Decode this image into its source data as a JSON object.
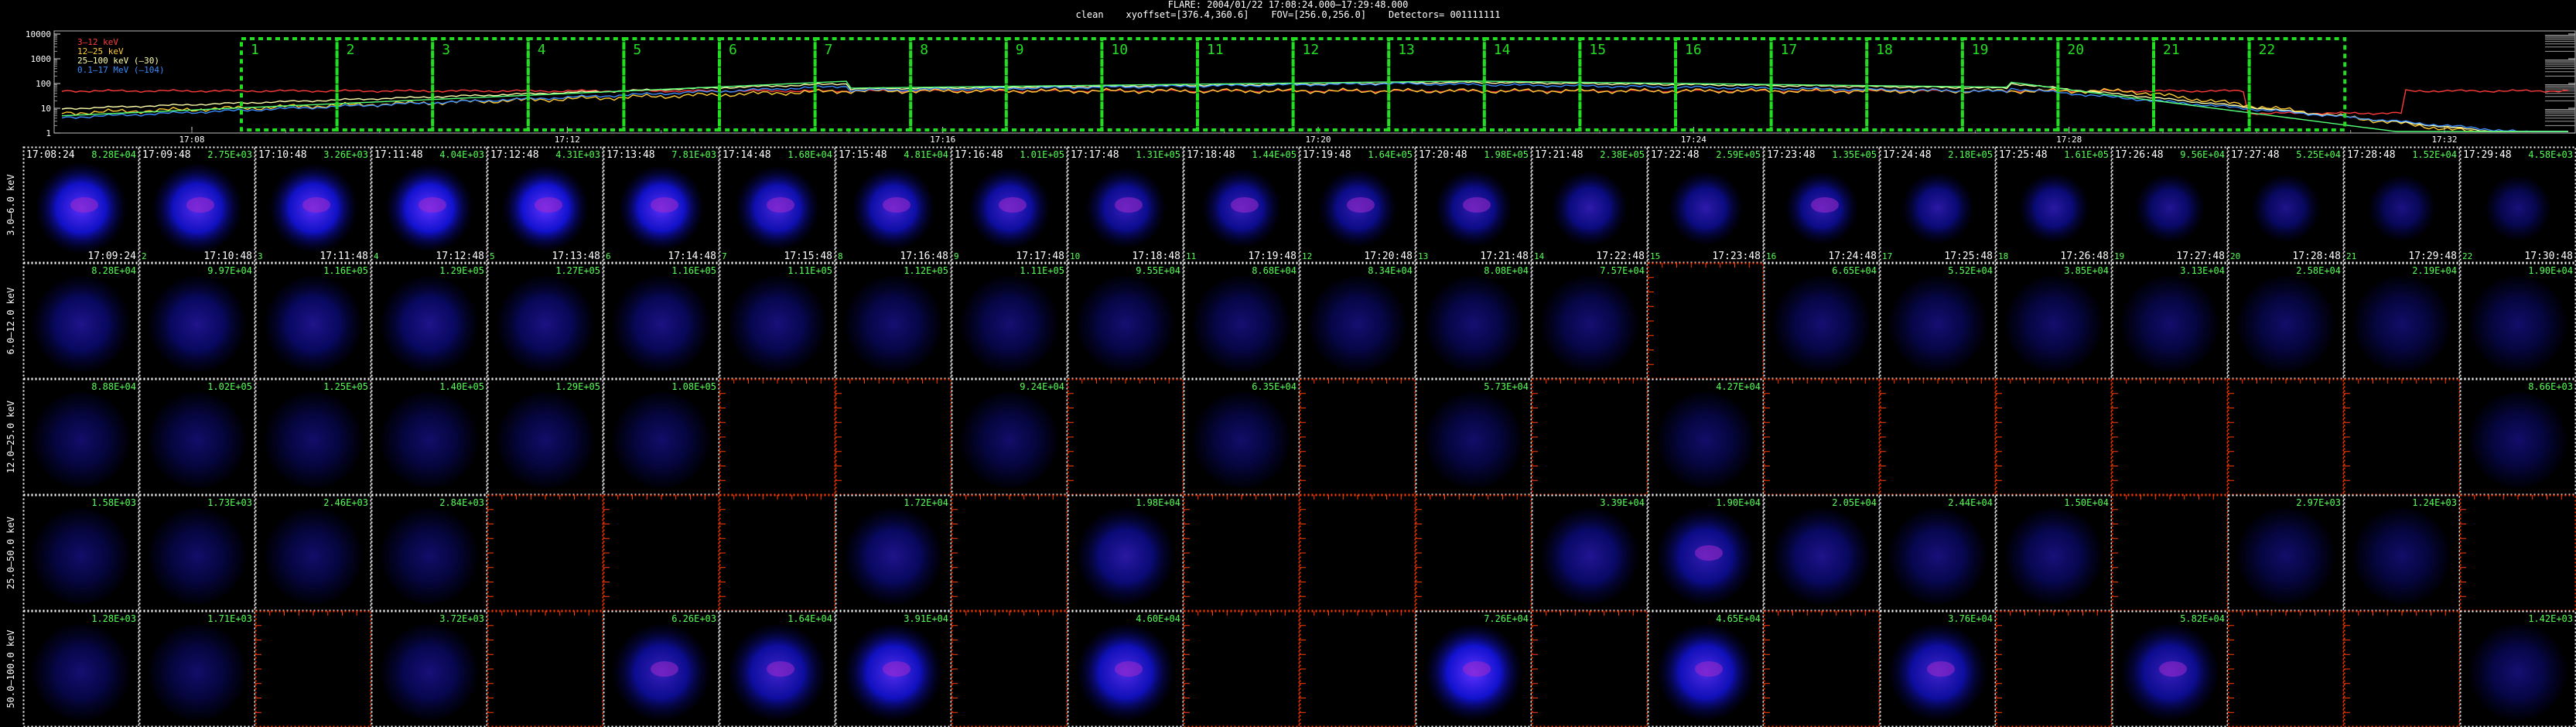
{
  "header": {
    "line1": "FLARE: 2004/01/22 17:08:24.000–17:29:48.000",
    "line2": "clean    xyoffset=[376.4,360.6]    FOV=[256.0,256.0]    Detectors= 001111111"
  },
  "lightcurve": {
    "y_ticks": [
      "10000",
      "1000",
      "100",
      "10",
      "1"
    ],
    "x_ticks": [
      "17:08",
      "17:12",
      "17:16",
      "17:20",
      "17:24",
      "17:28",
      "17:32"
    ],
    "legend": [
      {
        "label": "3–12 keV",
        "color": "#ff3b3b"
      },
      {
        "label": "12–25 keV",
        "color": "#ffcc33"
      },
      {
        "label": "25–100 keV (–30)",
        "color": "#ffffaa"
      },
      {
        "label": "0.1–17 MeV (–104)",
        "color": "#3b8cff"
      }
    ],
    "interval_numbers": [
      "1",
      "2",
      "3",
      "4",
      "5",
      "6",
      "7",
      "8",
      "9",
      "10",
      "11",
      "12",
      "13",
      "14",
      "15",
      "16",
      "17",
      "18",
      "19",
      "20",
      "21",
      "22"
    ],
    "curve_color_green": "#55ff77"
  },
  "grid": {
    "energy_bands": [
      "3.0–6.0 keV",
      "6.0–12.0 keV",
      "12.0–25.0 keV",
      "25.0–50.0 keV",
      "50.0–100.0 keV"
    ],
    "start_times": [
      "17:08:24",
      "17:09:48",
      "17:10:48",
      "17:11:48",
      "17:12:48",
      "17:13:48",
      "17:14:48",
      "17:15:48",
      "17:16:48",
      "17:17:48",
      "17:18:48",
      "17:19:48",
      "17:20:48",
      "17:21:48",
      "17:22:48",
      "17:23:48",
      "17:24:48",
      "17:25:48",
      "17:26:48",
      "17:27:48",
      "17:28:48",
      "17:29:48"
    ],
    "end_times": [
      "17:09:24",
      "17:10:48",
      "17:11:48",
      "17:12:48",
      "17:13:48",
      "17:14:48",
      "17:15:48",
      "17:16:48",
      "17:17:48",
      "17:18:48",
      "17:19:48",
      "17:20:48",
      "17:21:48",
      "17:22:48",
      "17:23:48",
      "17:24:48",
      "17:25:48",
      "17:26:48",
      "17:27:48",
      "17:28:48",
      "17:29:48",
      "17:30:48"
    ],
    "bottom_index_numbers": [
      "2",
      "3",
      "4",
      "5",
      "6",
      "7",
      "8",
      "9",
      "10",
      "11",
      "12",
      "13",
      "14",
      "15",
      "16",
      "17",
      "18",
      "19",
      "20",
      "21",
      "22"
    ],
    "rows": [
      {
        "values": [
          "8.28E+04",
          "2.75E+03",
          "3.26E+03",
          "4.04E+03",
          "4.31E+03",
          "7.81E+03",
          "1.68E+04",
          "4.81E+04",
          "1.01E+05",
          "1.31E+05",
          "1.44E+05",
          "1.64E+05",
          "1.98E+05",
          "2.38E+05",
          "2.59E+05",
          "1.35E+05",
          "2.18E+05",
          "1.61E+05",
          "9.56E+04",
          "5.25E+04",
          "1.52E+04",
          "4.58E+03"
        ],
        "status": [
          "img",
          "img",
          "img",
          "img",
          "img",
          "img",
          "img",
          "img",
          "img",
          "img",
          "img",
          "img",
          "img",
          "img",
          "img",
          "img",
          "img",
          "img",
          "img",
          "img",
          "img",
          "img"
        ],
        "intensity": [
          0.95,
          0.9,
          0.95,
          1.0,
          1.0,
          0.95,
          0.8,
          0.75,
          0.7,
          0.6,
          0.6,
          0.55,
          0.55,
          0.5,
          0.5,
          0.55,
          0.45,
          0.45,
          0.35,
          0.3,
          0.25,
          0.2
        ]
      },
      {
        "values": [
          "8.28E+04",
          "9.97E+04",
          "1.16E+05",
          "1.29E+05",
          "1.27E+05",
          "1.16E+05",
          "1.11E+05",
          "1.12E+05",
          "1.11E+05",
          "9.55E+04",
          "8.68E+04",
          "8.34E+04",
          "8.08E+04",
          "7.57E+04",
          "",
          "6.65E+04",
          "5.52E+04",
          "3.85E+04",
          "3.13E+04",
          "2.58E+04",
          "2.19E+04",
          "1.90E+04"
        ],
        "status": [
          "img",
          "img",
          "img",
          "img",
          "img",
          "img",
          "img",
          "img",
          "img",
          "img",
          "img",
          "img",
          "img",
          "img",
          "black",
          "img",
          "img",
          "img",
          "img",
          "img",
          "img",
          "img"
        ],
        "intensity": [
          0.3,
          0.3,
          0.3,
          0.3,
          0.25,
          0.25,
          0.2,
          0.15,
          0.15,
          0.15,
          0.15,
          0.15,
          0.15,
          0.15,
          0,
          0.15,
          0.15,
          0.12,
          0.12,
          0.1,
          0.1,
          0.1
        ]
      },
      {
        "values": [
          "8.88E+04",
          "1.02E+05",
          "1.25E+05",
          "1.40E+05",
          "1.29E+05",
          "1.08E+05",
          "",
          "",
          "9.24E+04",
          "",
          "6.35E+04",
          "",
          "5.73E+04",
          "",
          "4.27E+04",
          "",
          "",
          "",
          "",
          "",
          "",
          "8.66E+03"
        ],
        "status": [
          "img",
          "img",
          "img",
          "img",
          "img",
          "img",
          "black",
          "black",
          "img",
          "black",
          "img",
          "black",
          "img",
          "black",
          "img",
          "black",
          "black",
          "black",
          "black",
          "black",
          "black",
          "img"
        ],
        "intensity": [
          0.1,
          0.1,
          0.1,
          0.1,
          0.1,
          0.1,
          0,
          0,
          0.1,
          0,
          0.1,
          0,
          0.1,
          0,
          0.1,
          0,
          0,
          0,
          0,
          0,
          0,
          0.1
        ]
      },
      {
        "values": [
          "1.58E+03",
          "1.73E+03",
          "2.46E+03",
          "2.84E+03",
          "",
          "",
          "",
          "1.72E+04",
          "",
          "1.98E+04",
          "",
          "",
          "",
          "3.39E+04",
          "1.90E+04",
          "2.05E+04",
          "2.44E+04",
          "1.50E+04",
          "",
          "2.97E+03",
          "1.24E+03",
          ""
        ],
        "status": [
          "img",
          "img",
          "img",
          "img",
          "black",
          "black",
          "black",
          "img",
          "black",
          "img",
          "black",
          "black",
          "black",
          "img",
          "img",
          "img",
          "img",
          "img",
          "black",
          "img",
          "img",
          "black"
        ],
        "intensity": [
          0.1,
          0.1,
          0.1,
          0.1,
          0,
          0,
          0,
          0.3,
          0,
          0.45,
          0,
          0,
          0,
          0.35,
          0.55,
          0.3,
          0.2,
          0.2,
          0,
          0.1,
          0.1,
          0
        ]
      },
      {
        "values": [
          "1.28E+03",
          "1.71E+03",
          "",
          "3.72E+03",
          "",
          "6.26E+03",
          "1.64E+04",
          "3.91E+04",
          "",
          "4.60E+04",
          "",
          "",
          "7.26E+04",
          "",
          "4.65E+04",
          "",
          "3.76E+04",
          "",
          "5.82E+04",
          "",
          "",
          "1.42E+03"
        ],
        "status": [
          "img",
          "img",
          "black",
          "img",
          "black",
          "img",
          "img",
          "img",
          "black",
          "img",
          "black",
          "black",
          "img",
          "black",
          "img",
          "black",
          "img",
          "black",
          "img",
          "black",
          "black",
          "img"
        ],
        "intensity": [
          0.15,
          0.1,
          0,
          0.2,
          0,
          0.6,
          0.7,
          0.9,
          0,
          0.85,
          0,
          0,
          1.0,
          0,
          0.85,
          0,
          0.7,
          0,
          0.6,
          0,
          0,
          0.15
        ]
      }
    ]
  },
  "colors": {
    "background": "#000000",
    "value_label": "#55ff55",
    "image_blue": "#1e1eff",
    "black_panel_border": "#ff3a00",
    "grid_dots": "#ffffff"
  }
}
